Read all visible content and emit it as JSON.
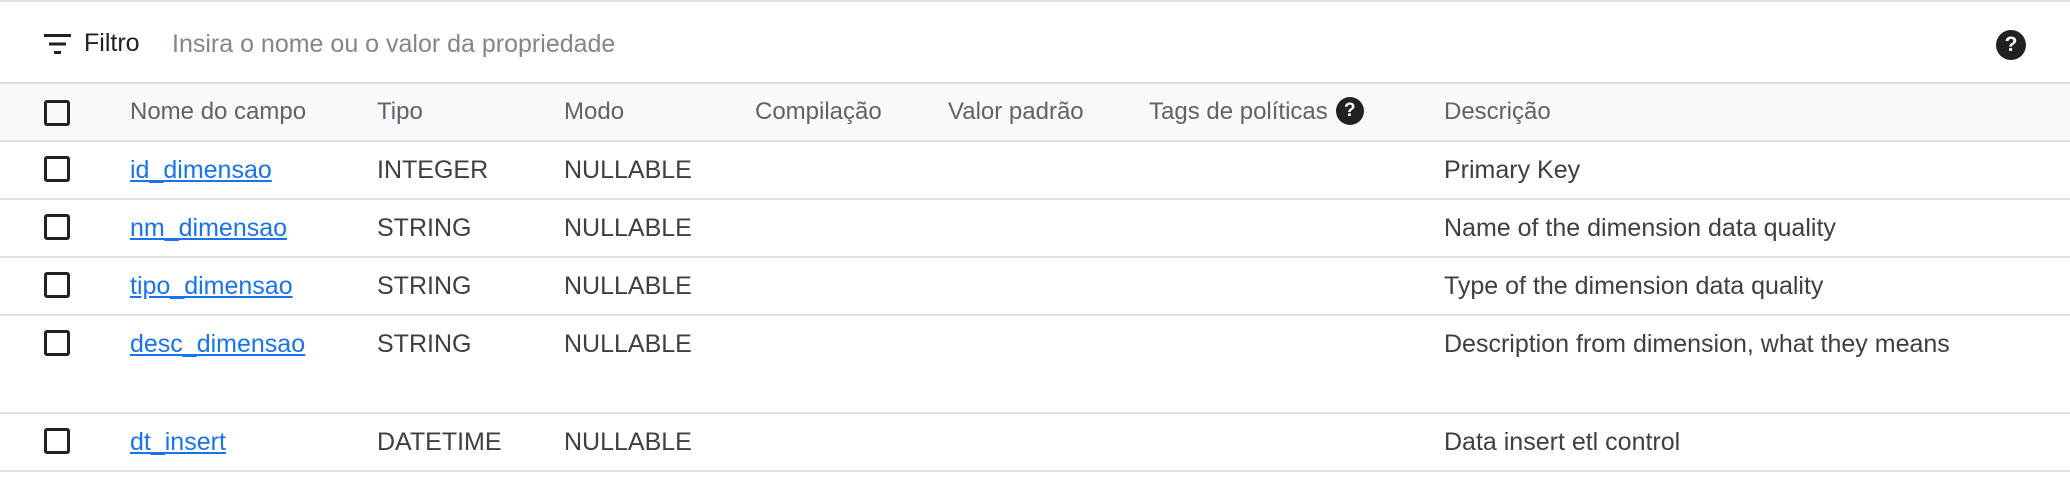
{
  "filter": {
    "label": "Filtro",
    "placeholder": "Insira o nome ou o valor da propriedade",
    "value": ""
  },
  "help_icon_glyph": "?",
  "columns": {
    "name": "Nome do campo",
    "type": "Tipo",
    "mode": "Modo",
    "collation": "Compilação",
    "default": "Valor padrão",
    "policy_tags": "Tags de políticas",
    "description": "Descrição"
  },
  "rows": [
    {
      "name": "id_dimensao",
      "type": "INTEGER",
      "mode": "NULLABLE",
      "collation": "",
      "default": "",
      "policy_tags": "",
      "description": "Primary Key"
    },
    {
      "name": "nm_dimensao",
      "type": "STRING",
      "mode": "NULLABLE",
      "collation": "",
      "default": "",
      "policy_tags": "",
      "description": "Name of the dimension data quality"
    },
    {
      "name": "tipo_dimensao",
      "type": "STRING",
      "mode": "NULLABLE",
      "collation": "",
      "default": "",
      "policy_tags": "",
      "description": "Type of the dimension data quality"
    },
    {
      "name": "desc_dimensao",
      "type": "STRING",
      "mode": "NULLABLE",
      "collation": "",
      "default": "",
      "policy_tags": "",
      "description": "Description from dimension, what they means"
    },
    {
      "name": "dt_insert",
      "type": "DATETIME",
      "mode": "NULLABLE",
      "collation": "",
      "default": "",
      "policy_tags": "",
      "description": "Data insert etl control"
    }
  ],
  "colors": {
    "link": "#1a73e8",
    "header_bg": "#f8f9fa",
    "divider": "#e0e0e0"
  }
}
